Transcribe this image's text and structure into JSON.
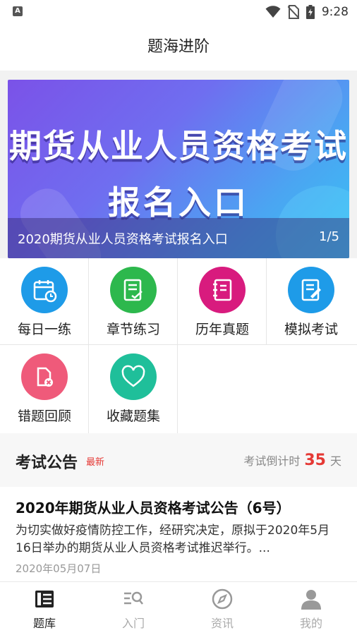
{
  "status_bar": {
    "time": "9:28",
    "indicator": "A",
    "icons": [
      "wifi-icon",
      "no-sim-icon",
      "battery-icon"
    ]
  },
  "header": {
    "title": "题海进阶"
  },
  "banner": {
    "headline_line1": "期货从业人员资格考试",
    "headline_line2": "报名入口",
    "caption": "2020期货从业人员资格考试报名入口",
    "pager": "1/5"
  },
  "features": [
    {
      "label": "每日一练",
      "icon": "calendar-clock-icon",
      "color": "#1e9be8"
    },
    {
      "label": "章节练习",
      "icon": "checklist-icon",
      "color": "#2db84d"
    },
    {
      "label": "历年真题",
      "icon": "notebook-icon",
      "color": "#d81b7e"
    },
    {
      "label": "模拟考试",
      "icon": "exam-paper-icon",
      "color": "#1e9be8"
    },
    {
      "label": "错题回顾",
      "icon": "wrong-question-icon",
      "color": "#ef5a7a"
    },
    {
      "label": "收藏题集",
      "icon": "heart-icon",
      "color": "#1fbf9a"
    }
  ],
  "notice": {
    "title": "考试公告",
    "badge": "最新",
    "countdown_label": "考试倒计时",
    "countdown_days": "35",
    "countdown_unit": "天"
  },
  "article": {
    "title": "2020年期货从业人员资格考试公告（6号）",
    "summary": "为切实做好疫情防控工作，经研究决定，原拟于2020年5月16日举办的期货从业人员资格考试推迟举行。...",
    "date": "2020年05月07日"
  },
  "tabs": [
    {
      "label": "题库",
      "icon": "question-bank-icon",
      "active": true
    },
    {
      "label": "入门",
      "icon": "intro-search-icon",
      "active": false
    },
    {
      "label": "资讯",
      "icon": "compass-icon",
      "active": false
    },
    {
      "label": "我的",
      "icon": "user-icon",
      "active": false
    }
  ]
}
